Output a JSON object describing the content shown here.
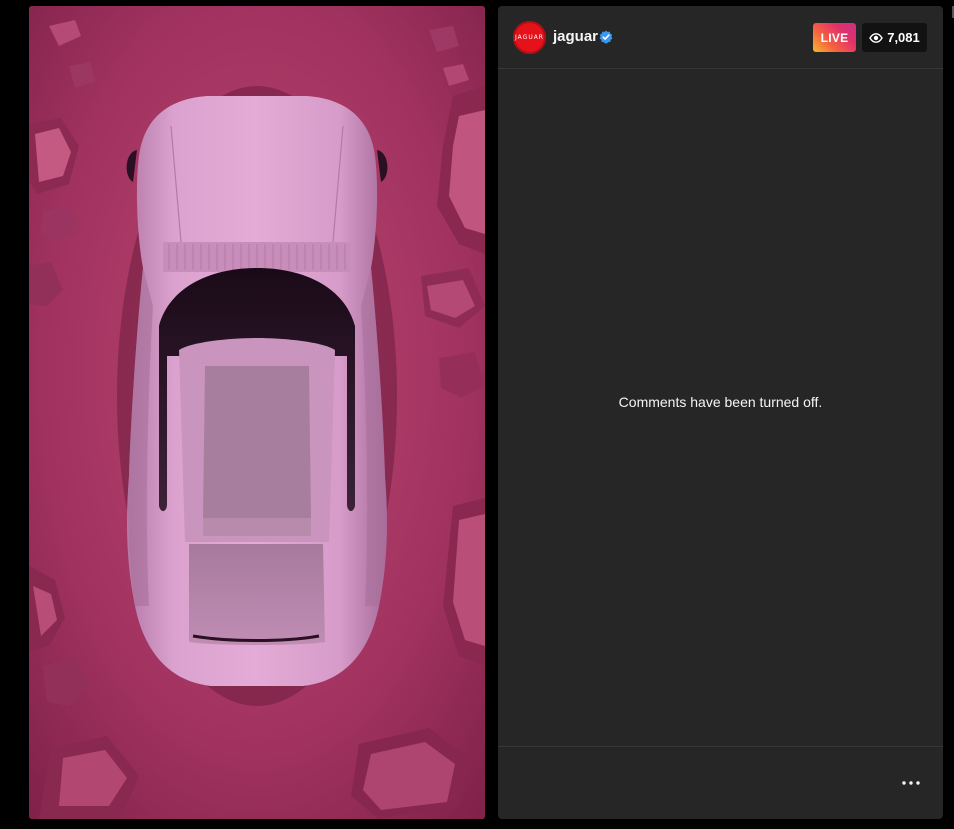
{
  "header": {
    "username": "jaguar",
    "avatar_icon": "jaguar-logo-icon",
    "avatar_text": "JAGUAR",
    "verified_icon": "verified-badge-icon",
    "live_label": "LIVE",
    "viewer_icon": "eye-icon",
    "viewer_count": "7,081"
  },
  "comments": {
    "status_text": "Comments have been turned off."
  },
  "footer": {
    "more_icon": "more-options-icon"
  },
  "colors": {
    "page_background": "#000000",
    "panel_background": "#262626",
    "avatar_red": "#e5121b",
    "verified_blue": "#3897f0",
    "live_gradient_start": "#f7b733",
    "live_gradient_end": "#c13584",
    "video_backdrop": "#a8365f",
    "car_body": "#d69ac8"
  }
}
